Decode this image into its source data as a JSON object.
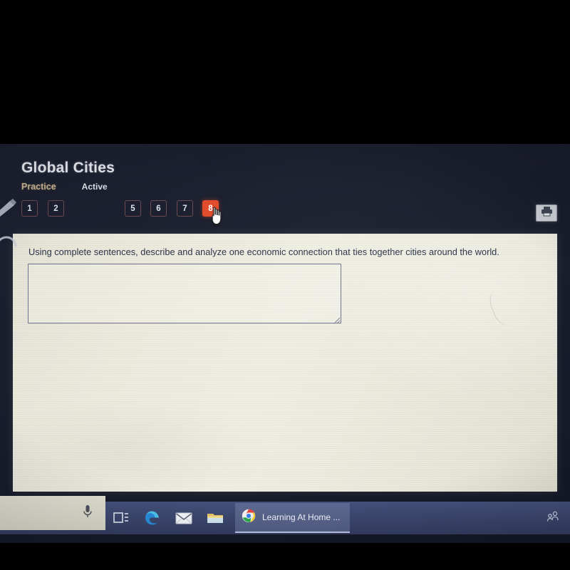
{
  "header": {
    "title": "Global Cities",
    "assignment_type": "Practice",
    "status": "Active"
  },
  "question_nav": {
    "tabs": [
      {
        "label": "1",
        "active": false
      },
      {
        "label": "2",
        "active": false
      },
      {
        "label": "5",
        "active": false
      },
      {
        "label": "6",
        "active": false
      },
      {
        "label": "7",
        "active": false
      },
      {
        "label": "8",
        "active": true
      }
    ],
    "active_tab": "8"
  },
  "toolbar": {
    "print_icon": "printer-icon",
    "pen_icon": "pen-icon",
    "headset_icon": "headset-icon"
  },
  "question": {
    "text": "Using complete sentences, describe and analyze one economic connection that ties together cities around the world.",
    "answer_value": "",
    "answer_placeholder": ""
  },
  "taskbar": {
    "mic_icon": "microphone-icon",
    "items": [
      {
        "icon": "task-view-icon",
        "label": ""
      },
      {
        "icon": "edge-browser-icon",
        "label": ""
      },
      {
        "icon": "mail-icon",
        "label": ""
      },
      {
        "icon": "file-explorer-icon",
        "label": ""
      }
    ],
    "active_window": {
      "icon": "chrome-icon",
      "label": "Learning At Home ..."
    },
    "systray": [
      {
        "icon": "people-icon"
      }
    ]
  },
  "colors": {
    "accent_active_tab": "#e04a2a",
    "tab_border": "#6b4b52",
    "practice_label": "#c9b491",
    "screen_background": "#1d2131",
    "paper_background": "#edece0",
    "taskbar": "#3a456b"
  }
}
